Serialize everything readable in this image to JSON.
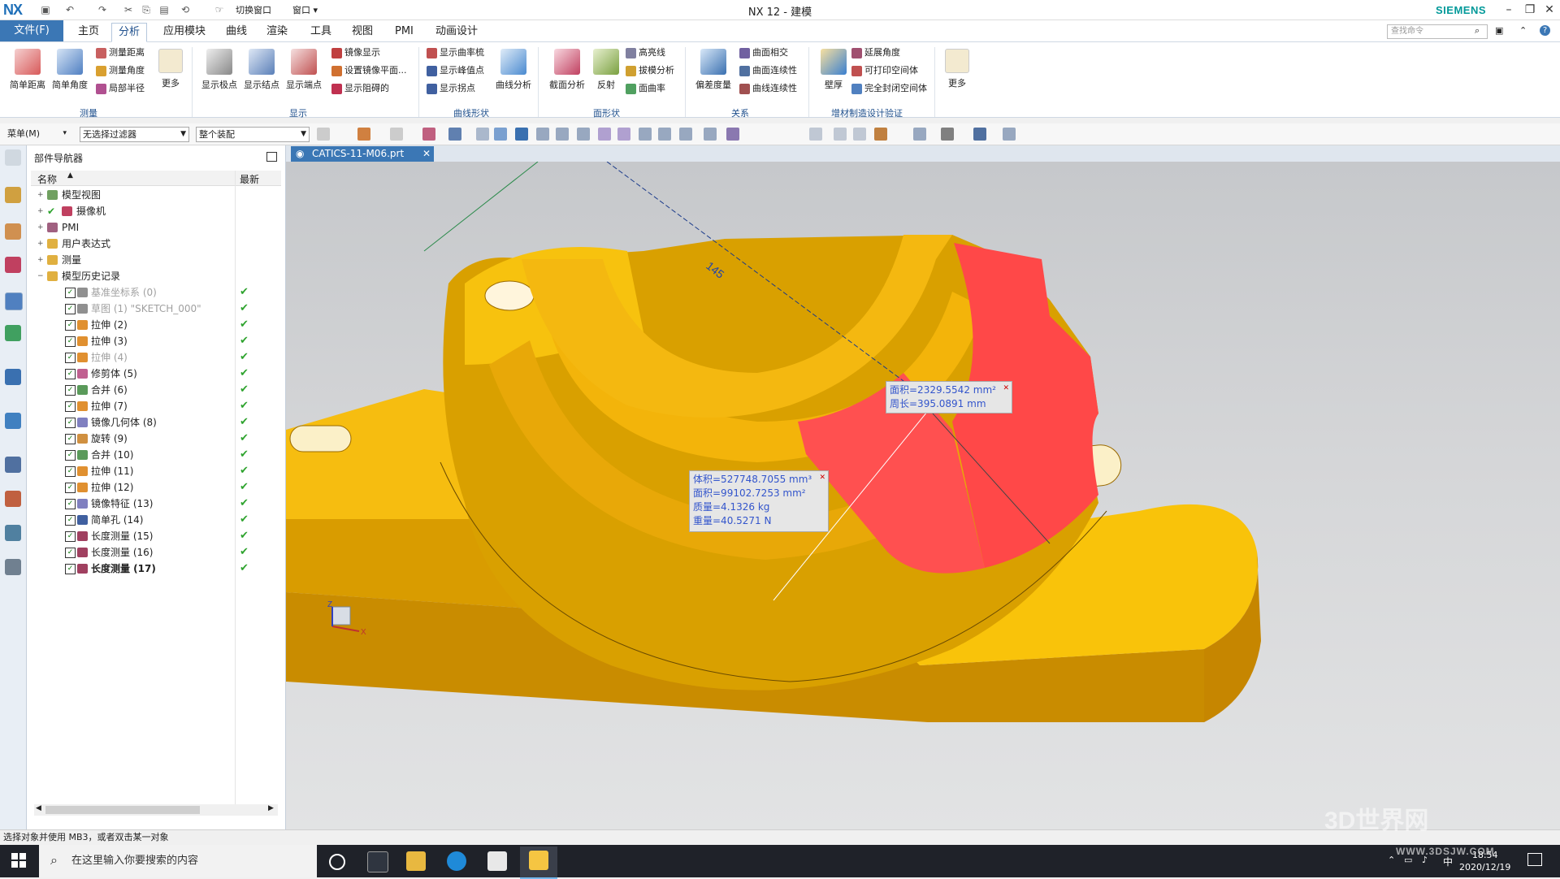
{
  "app": {
    "logo": "NX",
    "title": "NX 12 - 建模",
    "brand": "SIEMENS",
    "switch_window": "切换窗口",
    "window_menu": "窗口"
  },
  "menu": {
    "file": "文件(F)",
    "tabs": [
      "主页",
      "分析",
      "应用模块",
      "曲线",
      "渲染",
      "工具",
      "视图",
      "PMI",
      "动画设计"
    ],
    "active_tab": "分析",
    "search_placeholder": "查找命令"
  },
  "ribbon": {
    "measure": {
      "group": "测量",
      "big": [
        "简单距离",
        "简单角度"
      ],
      "small": [
        "测量距离",
        "测量角度",
        "局部半径"
      ],
      "more": "更多"
    },
    "display": {
      "group": "显示",
      "big": [
        "显示极点",
        "显示结点",
        "显示端点"
      ],
      "small": [
        "镜像显示",
        "设置镜像平面...",
        "显示阻碍的"
      ]
    },
    "curve_shape": {
      "group": "曲线形状",
      "small": [
        "显示曲率梳",
        "显示峰值点",
        "显示拐点"
      ],
      "big": "曲线分析"
    },
    "face_shape": {
      "group": "面形状",
      "big": [
        "截面分析",
        "反射"
      ],
      "small": [
        "高亮线",
        "拔模分析",
        "面曲率"
      ]
    },
    "relation": {
      "group": "关系",
      "big": "偏差度量",
      "small": [
        "曲面相交",
        "曲面连续性",
        "曲线连续性"
      ]
    },
    "am": {
      "group": "增材制造设计验证",
      "big": "壁厚",
      "small": [
        "延展角度",
        "可打印空间体",
        "完全封闭空间体"
      ]
    },
    "more": "更多"
  },
  "toolbar2": {
    "menu": "菜单(M)",
    "filter": "无选择过滤器",
    "scope": "整个装配"
  },
  "navigator": {
    "title": "部件导航器",
    "col_name": "名称",
    "col_latest": "最新",
    "folders": [
      "模型视图",
      "摄像机",
      "PMI",
      "用户表达式",
      "测量",
      "模型历史记录"
    ],
    "history": [
      {
        "label": "基准坐标系 (0)",
        "dim": true
      },
      {
        "label": "草图 (1) \"SKETCH_000\"",
        "dim": true
      },
      {
        "label": "拉伸 (2)",
        "dim": false
      },
      {
        "label": "拉伸 (3)",
        "dim": false
      },
      {
        "label": "拉伸 (4)",
        "dim": true
      },
      {
        "label": "修剪体 (5)",
        "dim": false
      },
      {
        "label": "合并 (6)",
        "dim": false
      },
      {
        "label": "拉伸 (7)",
        "dim": false
      },
      {
        "label": "镜像几何体 (8)",
        "dim": false
      },
      {
        "label": "旋转 (9)",
        "dim": false
      },
      {
        "label": "合并 (10)",
        "dim": false
      },
      {
        "label": "拉伸 (11)",
        "dim": false
      },
      {
        "label": "拉伸 (12)",
        "dim": false
      },
      {
        "label": "镜像特征 (13)",
        "dim": false
      },
      {
        "label": "简单孔 (14)",
        "dim": false
      },
      {
        "label": "长度测量 (15)",
        "dim": false
      },
      {
        "label": "长度测量 (16)",
        "dim": false
      },
      {
        "label": "长度测量 (17)",
        "dim": false,
        "bold": true
      }
    ]
  },
  "viewport": {
    "tab": "CATICS-11-M06.prt",
    "dimension": "145",
    "face_tip": [
      "面积=2329.5542 mm²",
      "周长=395.0891 mm"
    ],
    "body_tip": [
      "体积=527748.7055 mm³",
      "面积=99102.7253 mm²",
      "质量=4.1326 kg",
      "重量=40.5271 N"
    ],
    "triad": {
      "z": "Z",
      "x": "X"
    }
  },
  "status": "选择对象并使用 MB3，或者双击某一对象",
  "taskbar": {
    "search": "在这里输入你要搜索的内容",
    "time": "18:54",
    "date": "2020/12/19",
    "ime": "中"
  },
  "watermark": "3D世界网",
  "watermark_url": "WWW.3DSJW.COM",
  "colors": {
    "accent": "#3b77b5",
    "part": "#f2b000",
    "face_highlight": "#ff4848",
    "check": "#2ea32e"
  }
}
